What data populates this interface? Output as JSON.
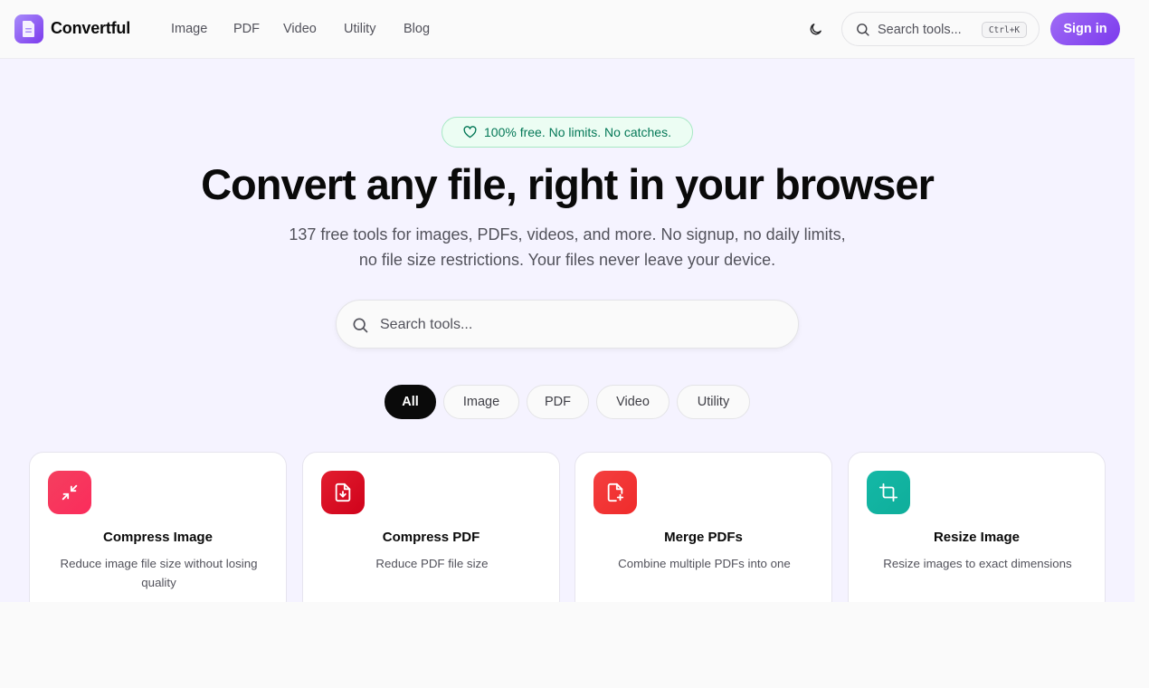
{
  "header": {
    "app_name": "Convertful",
    "nav": [
      {
        "label": "Image"
      },
      {
        "label": "PDF"
      },
      {
        "label": "Video"
      },
      {
        "label": "Utility"
      },
      {
        "label": "Blog"
      }
    ],
    "theme_icon": "moon-icon",
    "search": {
      "placeholder": "Search tools...",
      "shortcut": "Ctrl+K"
    },
    "sign_in_label": "Sign in",
    "accent_color": "#8b5cf6"
  },
  "hero": {
    "badge": "100% free. No limits. No catches.",
    "badge_icon": "heart-icon",
    "title": "Convert any file, right in your browser",
    "subtitle_line1": "137 free tools for images, PDFs, videos, and more. No signup, no daily limits,",
    "subtitle_line2": "no file size restrictions. Your files never leave your device.",
    "search_placeholder": "Search tools..."
  },
  "filters": {
    "options": [
      {
        "label": "All",
        "selected": true
      },
      {
        "label": "Image",
        "selected": false
      },
      {
        "label": "PDF",
        "selected": false
      },
      {
        "label": "Video",
        "selected": false
      },
      {
        "label": "Utility",
        "selected": false
      }
    ]
  },
  "tools": [
    {
      "title": "Compress Image",
      "description": "Reduce image file size without losing quality",
      "icon": "minimize-arrows-icon",
      "color": "#f43f5e"
    },
    {
      "title": "Compress PDF",
      "description": "Reduce PDF file size",
      "icon": "file-download-icon",
      "color": "#dc2626"
    },
    {
      "title": "Merge PDFs",
      "description": "Combine multiple PDFs into one",
      "icon": "file-plus-icon",
      "color": "#ef4444"
    },
    {
      "title": "Resize Image",
      "description": "Resize images to exact dimensions",
      "icon": "crop-icon",
      "color": "#14b8a6"
    }
  ]
}
